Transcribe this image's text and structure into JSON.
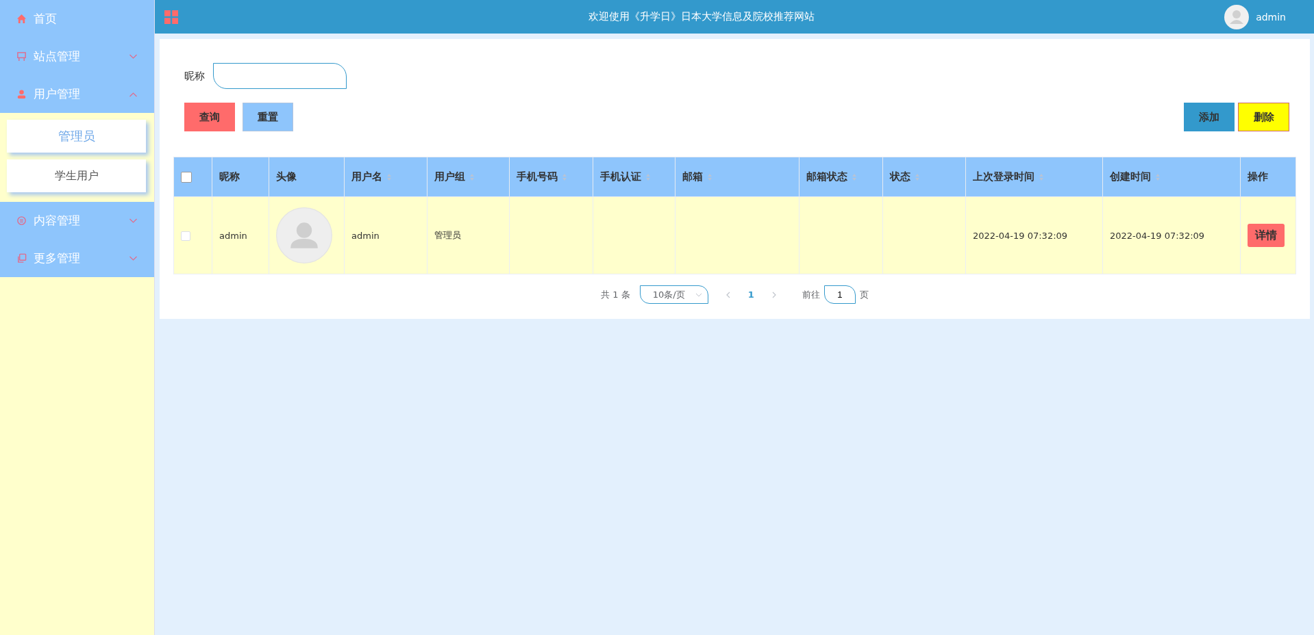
{
  "sidebar": {
    "items": [
      {
        "label": "首页"
      },
      {
        "label": "站点管理",
        "expanded": false
      },
      {
        "label": "用户管理",
        "expanded": true,
        "children": [
          {
            "label": "管理员",
            "selected": true
          },
          {
            "label": "学生用户",
            "selected": false
          }
        ]
      },
      {
        "label": "内容管理",
        "expanded": false
      },
      {
        "label": "更多管理",
        "expanded": false
      }
    ]
  },
  "header": {
    "title": "欢迎使用《升学日》日本大学信息及院校推荐网站",
    "user": "admin"
  },
  "search": {
    "label": "昵称"
  },
  "buttons": [
    {
      "label": "查询",
      "kind": "query"
    },
    {
      "label": "重置",
      "kind": "reset"
    },
    {
      "label": "添加",
      "kind": "add"
    },
    {
      "label": "删除",
      "kind": "delete"
    }
  ],
  "table": {
    "select_all": {
      "checked": false
    },
    "columns": [
      {
        "label": "昵称",
        "sortable": false
      },
      {
        "label": "头像",
        "sortable": false
      },
      {
        "label": "用户名",
        "sortable": true
      },
      {
        "label": "用户组",
        "sortable": true
      },
      {
        "label": "手机号码",
        "sortable": true
      },
      {
        "label": "手机认证",
        "sortable": true
      },
      {
        "label": "邮箱",
        "sortable": true
      },
      {
        "label": "邮箱状态",
        "sortable": true
      },
      {
        "label": "状态",
        "sortable": true
      },
      {
        "label": "上次登录时间",
        "sortable": true
      },
      {
        "label": "创建时间",
        "sortable": true
      },
      {
        "label": "操作",
        "sortable": false
      }
    ],
    "rows": [
      {
        "checked": false,
        "cells": [
          {
            "kind": "text",
            "text": "admin"
          },
          {
            "kind": "avatar"
          },
          {
            "kind": "text",
            "text": "admin"
          },
          {
            "kind": "text",
            "text": "管理员"
          },
          {
            "kind": "blank"
          },
          {
            "kind": "blank"
          },
          {
            "kind": "blank"
          },
          {
            "kind": "blank"
          },
          {
            "kind": "blank"
          },
          {
            "kind": "text",
            "text": "2022-04-19 07:32:09"
          },
          {
            "kind": "text",
            "text": "2022-04-19 07:32:09"
          },
          {
            "kind": "action",
            "text": "详情"
          }
        ]
      }
    ]
  },
  "pagination": {
    "total": "共 1 条",
    "page_size": "10条/页",
    "pages": [
      {
        "label": "1",
        "selected": true
      }
    ],
    "goto_label": "前往",
    "goto_value": "1",
    "goto_suffix": "页"
  }
}
